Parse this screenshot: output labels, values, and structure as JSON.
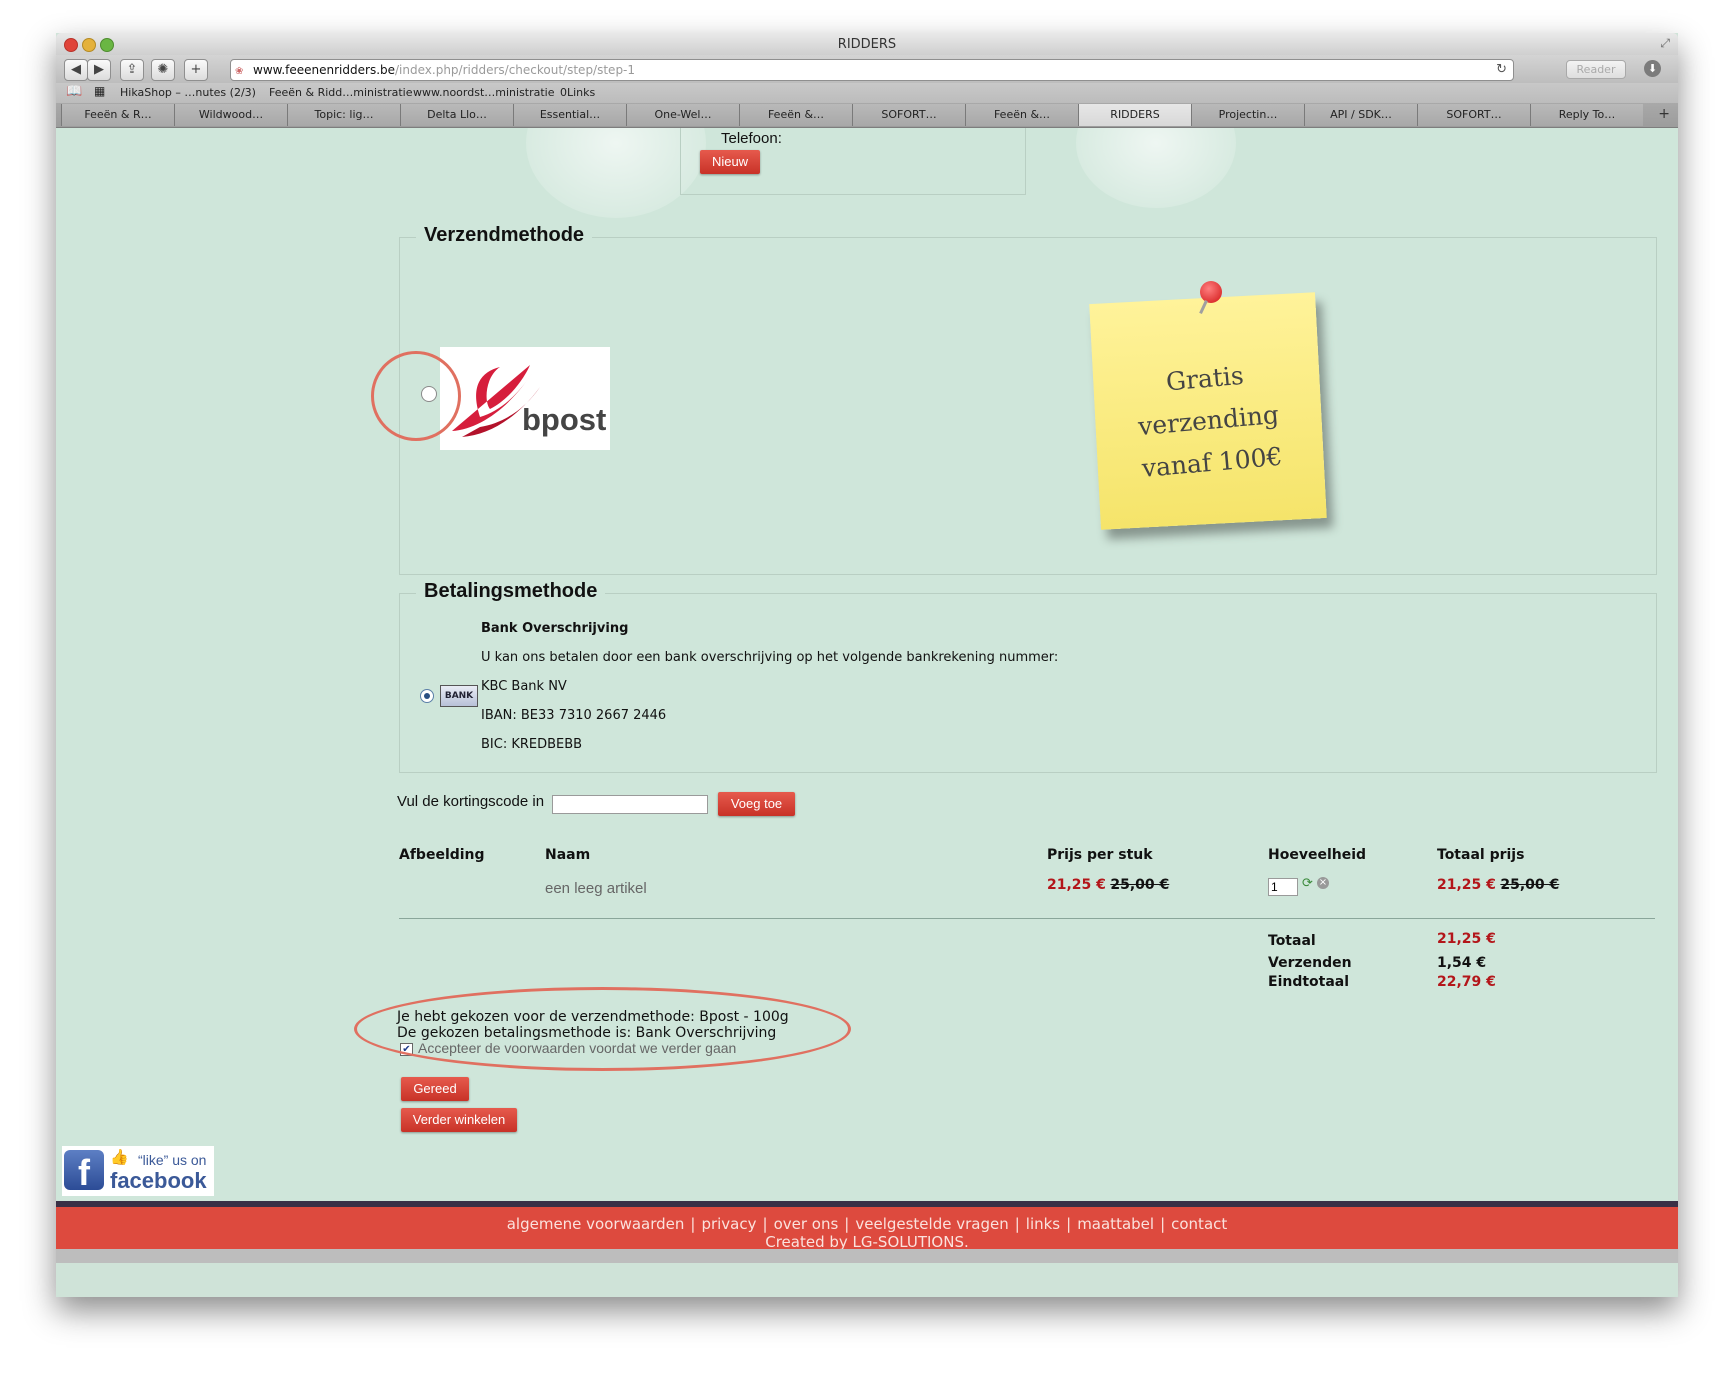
{
  "window": {
    "title": "RIDDERS"
  },
  "toolbar": {
    "url_host": "www.feeenenridders.be",
    "url_path": "/index.php/ridders/checkout/step/step-1",
    "reader_label": "Reader"
  },
  "bookmarks": [
    "HikaShop – …nutes (2/3)",
    "Feeën & Ridd…ministratie",
    "www.noordst…ministratie",
    "0Links"
  ],
  "tabs": [
    "Feeën & R…",
    "Wildwood…",
    "Topic: lig…",
    "Delta Llo…",
    "Essential…",
    "One-Wel…",
    "Feeën &…",
    "SOFORT…",
    "Feeën &…",
    "RIDDERS",
    "Projectin…",
    "API / SDK…",
    "SOFORT…",
    "Reply To…"
  ],
  "address": {
    "phone_label": "Telefoon:",
    "new_button": "Nieuw"
  },
  "shipping": {
    "heading": "Verzendmethode",
    "bpost_logo_text": "bpost",
    "note_line1": "Gratis verzending",
    "note_line2": "vanaf 100€"
  },
  "payment": {
    "heading": "Betalingsmethode",
    "bank_icon_text": "BANK",
    "method_name": "Bank Overschrijving",
    "description": "U kan ons betalen door een bank overschrijving op het volgende bankrekening nummer:",
    "bank_name": "KBC Bank NV",
    "iban": "IBAN: BE33 7310 2667 2446",
    "bic": "BIC: KREDBEBB"
  },
  "coupon": {
    "label": "Vul de kortingscode in",
    "value": "",
    "button": "Voeg toe"
  },
  "cart": {
    "headers": {
      "image": "Afbeelding",
      "name": "Naam",
      "unit_price": "Prijs per stuk",
      "quantity": "Hoeveelheid",
      "total": "Totaal prijs"
    },
    "row": {
      "name": "een leeg artikel",
      "unit_price": "21,25 €",
      "unit_price_old": "25,00 €",
      "quantity": "1",
      "total": "21,25 €",
      "total_old": "25,00 €"
    },
    "totals": {
      "subtotal_label": "Totaal",
      "subtotal": "21,25 €",
      "shipping_label": "Verzenden",
      "shipping": "1,54 €",
      "grand_label": "Eindtotaal",
      "grand": "22,79 €"
    }
  },
  "summary": {
    "shipping_choice": "Je hebt gekozen voor de verzendmethode: Bpost - 100g",
    "payment_choice": "De gekozen betalingsmethode is: Bank Overschrijving",
    "terms": "Accepteer de voorwaarden voordat we verder gaan"
  },
  "buttons": {
    "done": "Gereed",
    "continue": "Verder winkelen"
  },
  "facebook": {
    "like_text": "“like” us on",
    "brand": "facebook"
  },
  "footer": {
    "links": [
      "algemene voorwaarden",
      "privacy",
      "over ons",
      "veelgestelde vragen",
      "links",
      "maattabel",
      "contact"
    ],
    "credit": "Created by LG-SOLUTIONS."
  },
  "colors": {
    "accent_red": "#d9443a",
    "page_bg": "#cfe6da",
    "annotation": "#e07060",
    "note_yellow": "#fbee82"
  }
}
